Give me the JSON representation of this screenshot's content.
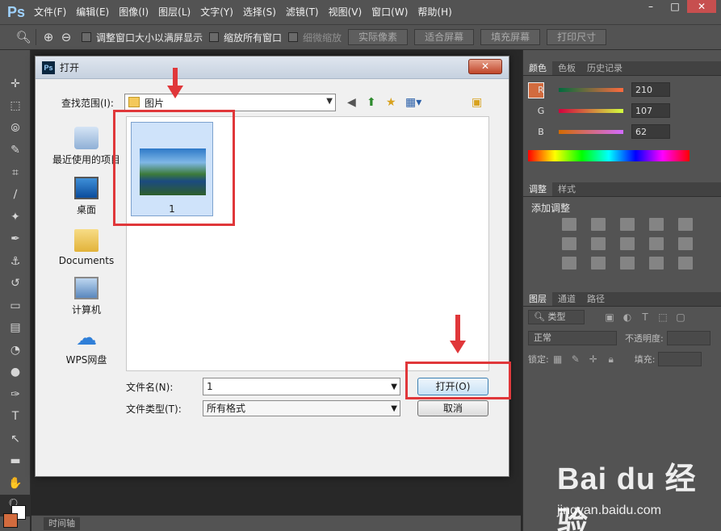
{
  "app": {
    "logo": "Ps",
    "menus": [
      "文件(F)",
      "编辑(E)",
      "图像(I)",
      "图层(L)",
      "文字(Y)",
      "选择(S)",
      "滤镜(T)",
      "视图(V)",
      "窗口(W)",
      "帮助(H)"
    ],
    "window_controls": [
      "–",
      "□",
      "✕"
    ]
  },
  "options_bar": {
    "check_resize_windows": "调整窗口大小以满屏显示",
    "check_zoom_all": "缩放所有窗口",
    "check_scrubby_zoom": "细微缩放",
    "btn_actual_pixels": "实际像素",
    "btn_fit_screen": "适合屏幕",
    "btn_fill_screen": "填充屏幕",
    "btn_print_size": "打印尺寸"
  },
  "timeline": {
    "tab_label": "时间轴"
  },
  "color_panel": {
    "tabs": [
      "颜色",
      "色板",
      "历史记录"
    ],
    "r_label": "R",
    "g_label": "G",
    "b_label": "B",
    "r_value": "210",
    "g_value": "107",
    "b_value": "62",
    "foreground_color": "#d26b3e"
  },
  "adjust_panel": {
    "tabs": [
      "调整",
      "样式"
    ],
    "heading": "添加调整"
  },
  "layers_panel": {
    "tabs": [
      "图层",
      "通道",
      "路径"
    ],
    "filter_type": "类型",
    "blend_mode": "正常",
    "opacity_label": "不透明度:",
    "lock_label": "锁定:",
    "fill_label": "填充:"
  },
  "dialog": {
    "title": "打开",
    "look_in_label": "查找范围(I):",
    "look_in_value": "图片",
    "places": [
      "最近使用的项目",
      "桌面",
      "Documents",
      "计算机",
      "WPS网盘"
    ],
    "file_item_name": "1",
    "filename_label": "文件名(N):",
    "filename_value": "1",
    "filetype_label": "文件类型(T):",
    "filetype_value": "所有格式",
    "open_button": "打开(O)",
    "cancel_button": "取消",
    "close_button": "✕"
  },
  "watermark": {
    "main": "Bai du 经验",
    "sub": "jingyan.baidu.com"
  }
}
